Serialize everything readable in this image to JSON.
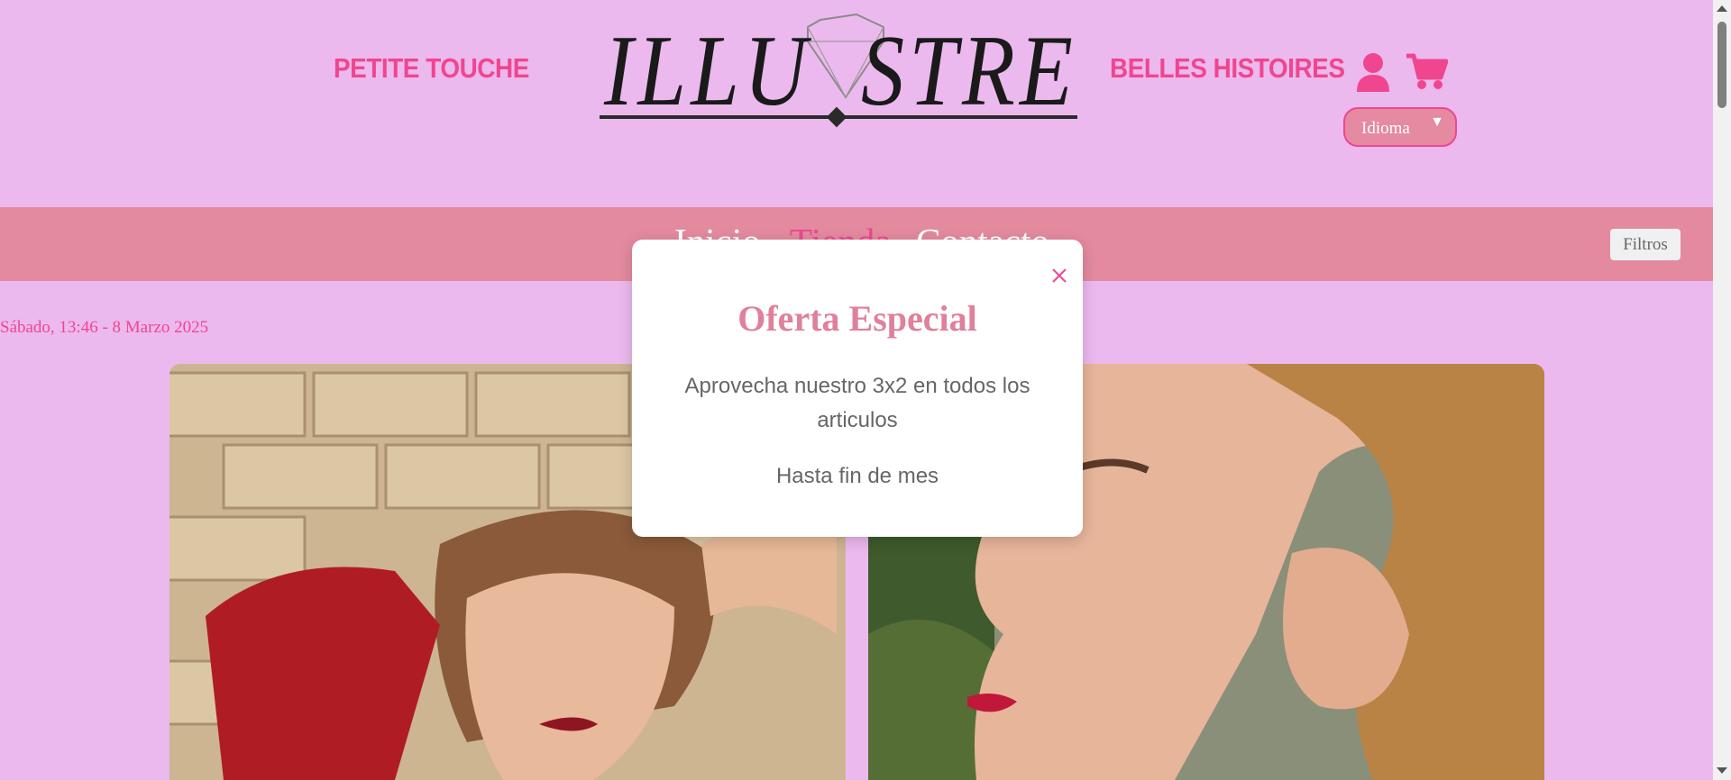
{
  "header": {
    "left_link": "PETITE TOUCHE",
    "right_link": "BELLES HISTOIRES",
    "logo_text": "ILLUSTRE",
    "language_label": "Idioma",
    "language_arrow": "▼"
  },
  "nav": {
    "items": [
      "Inicio",
      "Tienda",
      "Contacto"
    ],
    "active": "Tienda",
    "filters_label": "Filtros"
  },
  "date_text": "Sábado, 13:46 - 8 Marzo 2025",
  "modal": {
    "title": "Oferta Especial",
    "line1": "Aprovecha nuestro 3x2 en todos los articulos",
    "line2": "Hasta fin de mes"
  },
  "colors": {
    "background": "#ecb9ee",
    "accent": "#f0468f",
    "navbar": "#e38a9f",
    "modal_title": "#e0809a"
  },
  "icons": [
    "user-icon",
    "cart-icon",
    "close-icon",
    "diamond-icon"
  ]
}
